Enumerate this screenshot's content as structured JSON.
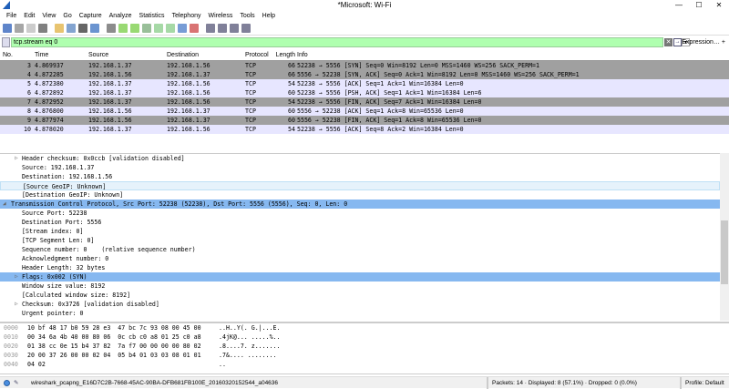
{
  "window": {
    "title": "*Microsoft: Wi-Fi",
    "minimize": "—",
    "maximize": "☐",
    "close": "✕"
  },
  "menu": [
    "File",
    "Edit",
    "View",
    "Go",
    "Capture",
    "Analyze",
    "Statistics",
    "Telephony",
    "Wireless",
    "Tools",
    "Help"
  ],
  "toolbar_icons": [
    "start-capture-icon",
    "stop-capture-icon",
    "restart-capture-icon",
    "capture-options-icon",
    "open-file-icon",
    "save-file-icon",
    "close-file-icon",
    "reload-icon",
    "find-packet-icon",
    "go-back-icon",
    "go-forward-icon",
    "go-to-packet-icon",
    "go-first-icon",
    "go-last-icon",
    "autoscroll-icon",
    "colorize-icon",
    "zoom-in-icon",
    "zoom-out-icon",
    "zoom-normal-icon",
    "resize-columns-icon"
  ],
  "filter": {
    "value": "tcp.stream eq 0",
    "expression_label": "Expression…",
    "plus": "+"
  },
  "packet_list": {
    "columns": [
      "No.",
      "Time",
      "Source",
      "Destination",
      "Protocol",
      "Length",
      "Info"
    ],
    "rows": [
      {
        "no": "3",
        "time": "4.869937",
        "src": "192.168.1.37",
        "dst": "192.168.1.56",
        "proto": "TCP",
        "len": "66",
        "info": "52238 → 5556 [SYN] Seq=0 Win=8192 Len=0 MSS=1460 WS=256 SACK_PERM=1",
        "style": "g"
      },
      {
        "no": "4",
        "time": "4.872285",
        "src": "192.168.1.56",
        "dst": "192.168.1.37",
        "proto": "TCP",
        "len": "66",
        "info": "5556 → 52238 [SYN, ACK] Seq=0 Ack=1 Win=8192 Len=0 MSS=1460 WS=256 SACK_PERM=1",
        "style": "g"
      },
      {
        "no": "5",
        "time": "4.872380",
        "src": "192.168.1.37",
        "dst": "192.168.1.56",
        "proto": "TCP",
        "len": "54",
        "info": "52238 → 5556 [ACK] Seq=1 Ack=1 Win=16384 Len=0",
        "style": "l"
      },
      {
        "no": "6",
        "time": "4.872892",
        "src": "192.168.1.37",
        "dst": "192.168.1.56",
        "proto": "TCP",
        "len": "60",
        "info": "52238 → 5556 [PSH, ACK] Seq=1 Ack=1 Win=16384 Len=6",
        "style": "l"
      },
      {
        "no": "7",
        "time": "4.872952",
        "src": "192.168.1.37",
        "dst": "192.168.1.56",
        "proto": "TCP",
        "len": "54",
        "info": "52238 → 5556 [FIN, ACK] Seq=7 Ack=1 Win=16384 Len=0",
        "style": "g"
      },
      {
        "no": "8",
        "time": "4.876800",
        "src": "192.168.1.56",
        "dst": "192.168.1.37",
        "proto": "TCP",
        "len": "60",
        "info": "5556 → 52238 [ACK] Seq=1 Ack=8 Win=65536 Len=0",
        "style": "l"
      },
      {
        "no": "9",
        "time": "4.877974",
        "src": "192.168.1.56",
        "dst": "192.168.1.37",
        "proto": "TCP",
        "len": "60",
        "info": "5556 → 52238 [FIN, ACK] Seq=1 Ack=8 Win=65536 Len=0",
        "style": "g"
      },
      {
        "no": "10",
        "time": "4.878020",
        "src": "192.168.1.37",
        "dst": "192.168.1.56",
        "proto": "TCP",
        "len": "54",
        "info": "52238 → 5556 [ACK] Seq=8 Ack=2 Win=16384 Len=0",
        "style": "l"
      }
    ]
  },
  "details": [
    {
      "text": "Header checksum: 0x0ccb [validation disabled]",
      "level": 1,
      "expander": "▷"
    },
    {
      "text": "Source: 192.168.1.37",
      "level": 1
    },
    {
      "text": "Destination: 192.168.1.56",
      "level": 1
    },
    {
      "text": "[Source GeoIP: Unknown]",
      "level": 1,
      "state": "hov"
    },
    {
      "text": "[Destination GeoIP: Unknown]",
      "level": 1
    },
    {
      "text": "Transmission Control Protocol, Src Port: 52238 (52238), Dst Port: 5556 (5556), Seq: 0, Len: 0",
      "level": 0,
      "expander": "◢",
      "state": "sel"
    },
    {
      "text": "Source Port: 52238",
      "level": 1
    },
    {
      "text": "Destination Port: 5556",
      "level": 1
    },
    {
      "text": "[Stream index: 0]",
      "level": 1
    },
    {
      "text": "[TCP Segment Len: 0]",
      "level": 1
    },
    {
      "text": "Sequence number: 0    (relative sequence number)",
      "level": 1
    },
    {
      "text": "Acknowledgment number: 0",
      "level": 1
    },
    {
      "text": "Header Length: 32 bytes",
      "level": 1
    },
    {
      "text": "Flags: 0x002 (SYN)",
      "level": 1,
      "expander": "▷",
      "state": "sel"
    },
    {
      "text": "Window size value: 8192",
      "level": 1
    },
    {
      "text": "[Calculated window size: 8192]",
      "level": 1
    },
    {
      "text": "Checksum: 0x3726 [validation disabled]",
      "level": 1,
      "expander": "▷"
    },
    {
      "text": "Urgent pointer: 0",
      "level": 1
    }
  ],
  "hex": [
    {
      "off": "0000",
      "bytes": "10 bf 48 17 b0 59 28 e3  47 bc 7c 93 08 00 45 00",
      "ascii": "..H..Y(. G.|...E."
    },
    {
      "off": "0010",
      "bytes": "00 34 6a 4b 40 00 80 06  0c cb c0 a8 01 25 c0 a8",
      "ascii": ".4jK@... .....%.."
    },
    {
      "off": "0020",
      "bytes": "01 38 cc 0e 15 b4 37 82  7a f7 00 00 00 00 80 02",
      "ascii": ".8....7. z......."
    },
    {
      "off": "0030",
      "bytes": "20 00 37 26 00 00 02 04  05 b4 01 03 03 08 01 01",
      "ascii": " .7&.... ........"
    },
    {
      "off": "0040",
      "bytes": "04 02",
      "ascii": ".."
    }
  ],
  "status": {
    "file": "wireshark_pcapng_E16D7C2B-7668-45AC-90BA-DFB681FB100E_20160320152544_a04636",
    "packets": "Packets: 14 · Displayed: 8 (57.1%) · Dropped: 0 (0.0%)",
    "profile": "Profile: Default"
  }
}
